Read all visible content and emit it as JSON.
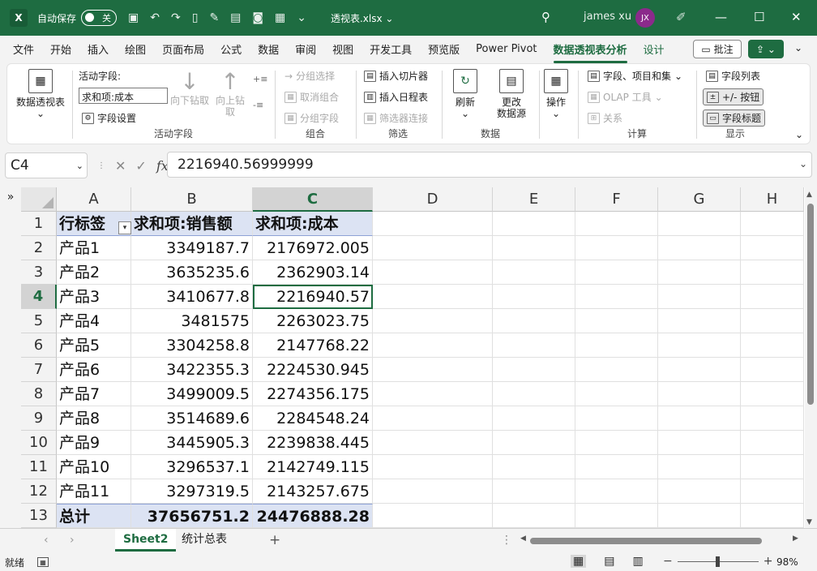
{
  "titlebar": {
    "app_icon": "excel-icon",
    "autosave_label": "自动保存",
    "autosave_state": "关",
    "filename": "透视表.xlsx",
    "user_name": "james xu",
    "avatar_initials": "JX"
  },
  "menu": {
    "items": [
      "文件",
      "开始",
      "插入",
      "绘图",
      "页面布局",
      "公式",
      "数据",
      "审阅",
      "视图",
      "开发工具",
      "预览版",
      "Power Pivot",
      "数据透视表分析",
      "设计"
    ],
    "active": "数据透视表分析",
    "comment_label": "批注"
  },
  "ribbon": {
    "pivot_table_label": "数据透视表",
    "active_field_label": "活动字段:",
    "active_field_value": "求和项:成本",
    "field_settings_label": "字段设置",
    "drill_down_label": "向下钻取",
    "drill_up_label": "向上钻取",
    "group_active_field": "活动字段",
    "group_selection_label": "分组选择",
    "ungroup_label": "取消组合",
    "group_field_label": "分组字段",
    "group_group": "组合",
    "insert_slicer_label": "插入切片器",
    "insert_timeline_label": "插入日程表",
    "filter_connections_label": "筛选器连接",
    "group_filter": "筛选",
    "refresh_label": "刷新",
    "change_source_label": "更改\n数据源",
    "group_data": "数据",
    "actions_label": "操作",
    "fields_items_sets_label": "字段、项目和集",
    "olap_tools_label": "OLAP 工具",
    "relationships_label": "关系",
    "group_calc": "计算",
    "field_list_label": "字段列表",
    "plus_minus_label": "+/- 按钮",
    "field_headers_label": "字段标题",
    "group_show": "显示"
  },
  "formula_bar": {
    "name_box": "C4",
    "formula": "2216940.56999999"
  },
  "grid": {
    "columns": [
      "A",
      "B",
      "C",
      "D",
      "E",
      "F",
      "G",
      "H"
    ],
    "rows": [
      "1",
      "2",
      "3",
      "4",
      "5",
      "6",
      "7",
      "8",
      "9",
      "10",
      "11",
      "12",
      "13"
    ],
    "header_row": [
      "行标签",
      "求和项:销售额",
      "求和项:成本"
    ],
    "data": [
      [
        "产品1",
        "3349187.7",
        "2176972.005"
      ],
      [
        "产品2",
        "3635235.6",
        "2362903.14"
      ],
      [
        "产品3",
        "3410677.8",
        "2216940.57"
      ],
      [
        "产品4",
        "3481575",
        "2263023.75"
      ],
      [
        "产品5",
        "3304258.8",
        "2147768.22"
      ],
      [
        "产品6",
        "3422355.3",
        "2224530.945"
      ],
      [
        "产品7",
        "3499009.5",
        "2274356.175"
      ],
      [
        "产品8",
        "3514689.6",
        "2284548.24"
      ],
      [
        "产品9",
        "3445905.3",
        "2239838.445"
      ],
      [
        "产品10",
        "3296537.1",
        "2142749.115"
      ],
      [
        "产品11",
        "3297319.5",
        "2143257.675"
      ]
    ],
    "total_row": [
      "总计",
      "37656751.2",
      "24476888.28"
    ]
  },
  "sheets": {
    "tabs": [
      "Sheet2",
      "统计总表"
    ],
    "active": "Sheet2"
  },
  "status": {
    "ready": "就绪",
    "zoom": "98%"
  },
  "colors": {
    "accent": "#1e6c41",
    "pivot_header_fill": "#dce3f3"
  }
}
